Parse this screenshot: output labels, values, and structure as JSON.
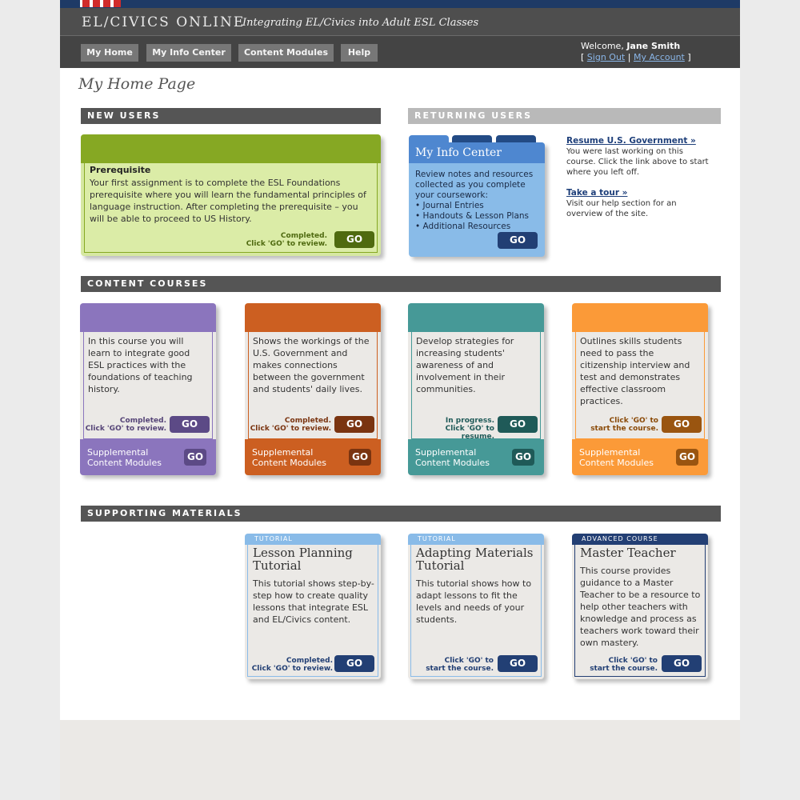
{
  "brand": "EL/CIVICS ONLINE",
  "tagline": "Integrating EL/Civics into Adult ESL Classes",
  "nav": [
    "My Home",
    "My Info Center",
    "Content Modules",
    "Help"
  ],
  "welcome": {
    "prefix": "Welcome, ",
    "name": "Jane Smith",
    "sign_out": "Sign Out",
    "my_account": "My Account",
    "lb": "[",
    "sep": "|",
    "rb": "]"
  },
  "page_title": "My Home Page",
  "new_users": {
    "heading": "NEW USERS",
    "card_title": "Prerequisite",
    "card_text": "Your first assignment is to complete the ESL Foundations prerequisite where you will learn the fundamental principles of language instruction. After completing the prerequisite – you will be able to proceed to US History.",
    "status_1": "Completed.",
    "status_2": "Click 'GO' to review.",
    "go": "GO"
  },
  "returning_users": {
    "heading": "RETURNING USERS",
    "info_title": "My Info Center",
    "info_text": "Review notes and resources collected as you complete your coursework:",
    "info_items": [
      "• Journal Entries",
      "• Handouts & Lesson Plans",
      "• Additional Resources"
    ],
    "go": "GO",
    "resume_link": "Resume U.S. Government »",
    "resume_text": "You were last working on this course. Click the link above to start where you left off.",
    "tour_link": "Take a tour »",
    "tour_text": "Visit our help section for an overview of the site."
  },
  "content_courses": {
    "heading": "CONTENT COURSES",
    "cards": [
      {
        "text": "In this course you will learn to integrate good ESL practices with the foundations of teaching history.",
        "status_1": "Completed.",
        "status_2": "Click 'GO' to review.",
        "go": "GO",
        "supp_1": "Supplemental",
        "supp_2": "Content Modules",
        "supp_go": "GO"
      },
      {
        "text": "Shows the workings of the U.S. Government and makes connections between the government and students' daily lives.",
        "status_1": "Completed.",
        "status_2": "Click 'GO' to review.",
        "go": "GO",
        "supp_1": "Supplemental",
        "supp_2": "Content Modules",
        "supp_go": "GO"
      },
      {
        "text": "Develop strategies for increasing students' awareness of and involvement in their communities.",
        "status_1": "In progress.",
        "status_2": "Click 'GO' to resume.",
        "go": "GO",
        "supp_1": "Supplemental",
        "supp_2": "Content Modules",
        "supp_go": "GO"
      },
      {
        "text": "Outlines skills students need to pass the citizenship interview and test and demonstrates effective classroom practices.",
        "status_1": "Click 'GO' to",
        "status_2": "start the course.",
        "go": "GO",
        "supp_1": "Supplemental",
        "supp_2": "Content Modules",
        "supp_go": "GO"
      }
    ]
  },
  "supporting": {
    "heading": "SUPPORTING MATERIALS",
    "cards": [
      {
        "tag": "TUTORIAL",
        "title_1": "Lesson Planning",
        "title_2": "Tutorial",
        "text": "This tutorial shows step-by-step how to create quality lessons that integrate ESL and EL/Civics content.",
        "status_1": "Completed.",
        "status_2": "Click 'GO' to review.",
        "go": "GO"
      },
      {
        "tag": "TUTORIAL",
        "title_1": "Adapting Materials",
        "title_2": "Tutorial",
        "text": "This tutorial shows how to adapt lessons to fit the levels and needs of your students.",
        "status_1": "Click 'GO' to",
        "status_2": "start the course.",
        "go": "GO"
      },
      {
        "tag": "ADVANCED COURSE",
        "title_1": "Master Teacher",
        "title_2": "",
        "text": "This course provides guidance to a Master Teacher to be a resource to help other teachers with knowledge and process as teachers work toward their own mastery.",
        "status_1": "Click 'GO' to",
        "status_2": "start the course.",
        "go": "GO"
      }
    ]
  },
  "colors": {
    "green": "#86a823",
    "purple": "#8b75bd",
    "rust": "#cc5f21",
    "teal": "#469997",
    "orange": "#fb9a38",
    "navy": "#233f74",
    "sky": "#89bbe8"
  }
}
